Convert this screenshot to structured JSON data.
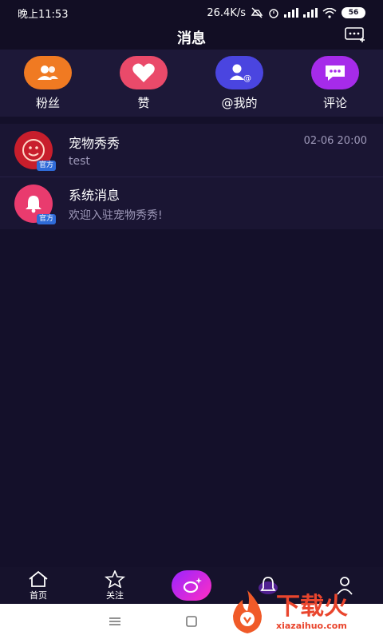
{
  "status": {
    "time": "晚上11:53",
    "speed": "26.4K/s",
    "battery": "56"
  },
  "header": {
    "title": "消息"
  },
  "categories": [
    {
      "label": "粉丝",
      "color": "#f07a22",
      "icon": "fans-icon"
    },
    {
      "label": "赞",
      "color": "#ea4a6a",
      "icon": "heart-icon"
    },
    {
      "label": "@我的",
      "color": "#4a45e0",
      "icon": "mention-icon"
    },
    {
      "label": "评论",
      "color": "#a62bea",
      "icon": "comment-icon"
    }
  ],
  "messages": [
    {
      "title": "宠物秀秀",
      "subtitle": "test",
      "time": "02-06 20:00",
      "badge": "官方"
    },
    {
      "title": "系统消息",
      "subtitle": "欢迎入驻宠物秀秀!",
      "time": "",
      "badge": "官方"
    }
  ],
  "tabs": [
    {
      "label": "首页",
      "icon": "home-icon"
    },
    {
      "label": "关注",
      "icon": "star-icon"
    },
    {
      "label": "",
      "icon": "camera-icon"
    },
    {
      "label": "",
      "icon": "bell-icon"
    },
    {
      "label": "",
      "icon": "profile-icon"
    }
  ],
  "watermark": {
    "big": "下载火",
    "small": "xiazaihuo.com"
  }
}
